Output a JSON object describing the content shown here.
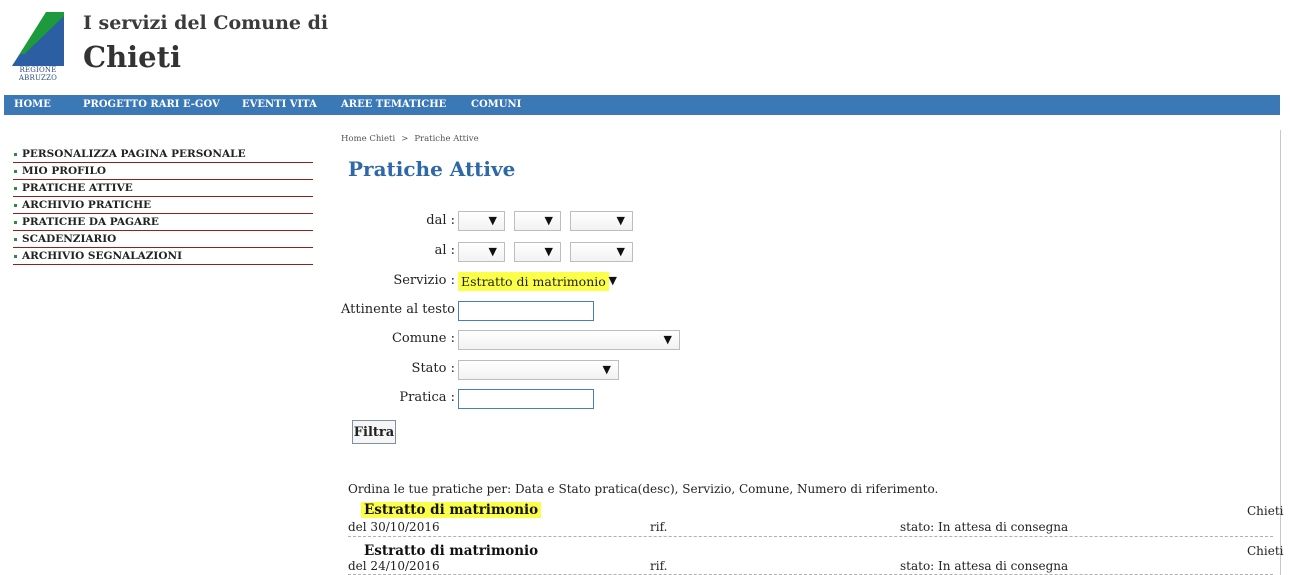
{
  "header": {
    "subtitle": "I servizi del Comune di",
    "city": "Chieti",
    "logo_text_line1": "REGIONE",
    "logo_text_line2": "ABRUZZO",
    "colors": {
      "logo_green": "#1c9a3c",
      "logo_blue": "#2c5ea3"
    }
  },
  "nav": {
    "items": [
      "HOME",
      "PROGETTO RARI E-GOV",
      "EVENTI VITA",
      "AREE TEMATICHE",
      "COMUNI"
    ],
    "color": "#3a78b6"
  },
  "sidebar": {
    "items": [
      "PERSONALIZZA PAGINA PERSONALE",
      "MIO PROFILO",
      "PRATICHE ATTIVE",
      "ARCHIVIO PRATICHE",
      "PRATICHE DA PAGARE",
      "SCADENZIARIO",
      "ARCHIVIO SEGNALAZIONI"
    ]
  },
  "breadcrumb": {
    "home": "Home Chieti",
    "separator": ">",
    "current": "Pratiche Attive"
  },
  "page": {
    "title": "Pratiche Attive"
  },
  "form": {
    "dal_label": "dal :",
    "al_label": "al :",
    "servizio_label": "Servizio :",
    "servizio_value": "Estratto di matrimonio",
    "attinente_label": "Attinente al testo :",
    "comune_label": "Comune :",
    "stato_label": "Stato :",
    "pratica_label": "Pratica :",
    "filter_button": "Filtra",
    "arrow": "▼"
  },
  "results": {
    "order_text": "Ordina le tue pratiche per: Data e Stato pratica(desc), Servizio, Comune, Numero di riferimento.",
    "items": [
      {
        "title": "Estratto di matrimonio",
        "date": "del 30/10/2016",
        "rif": "rif.",
        "stato": "stato: In attesa di consegna",
        "comune": "Chieti"
      },
      {
        "title": "Estratto di matrimonio",
        "date": "del 24/10/2016",
        "rif": "rif.",
        "stato": "stato: In attesa di consegna",
        "comune": "Chieti"
      }
    ]
  }
}
